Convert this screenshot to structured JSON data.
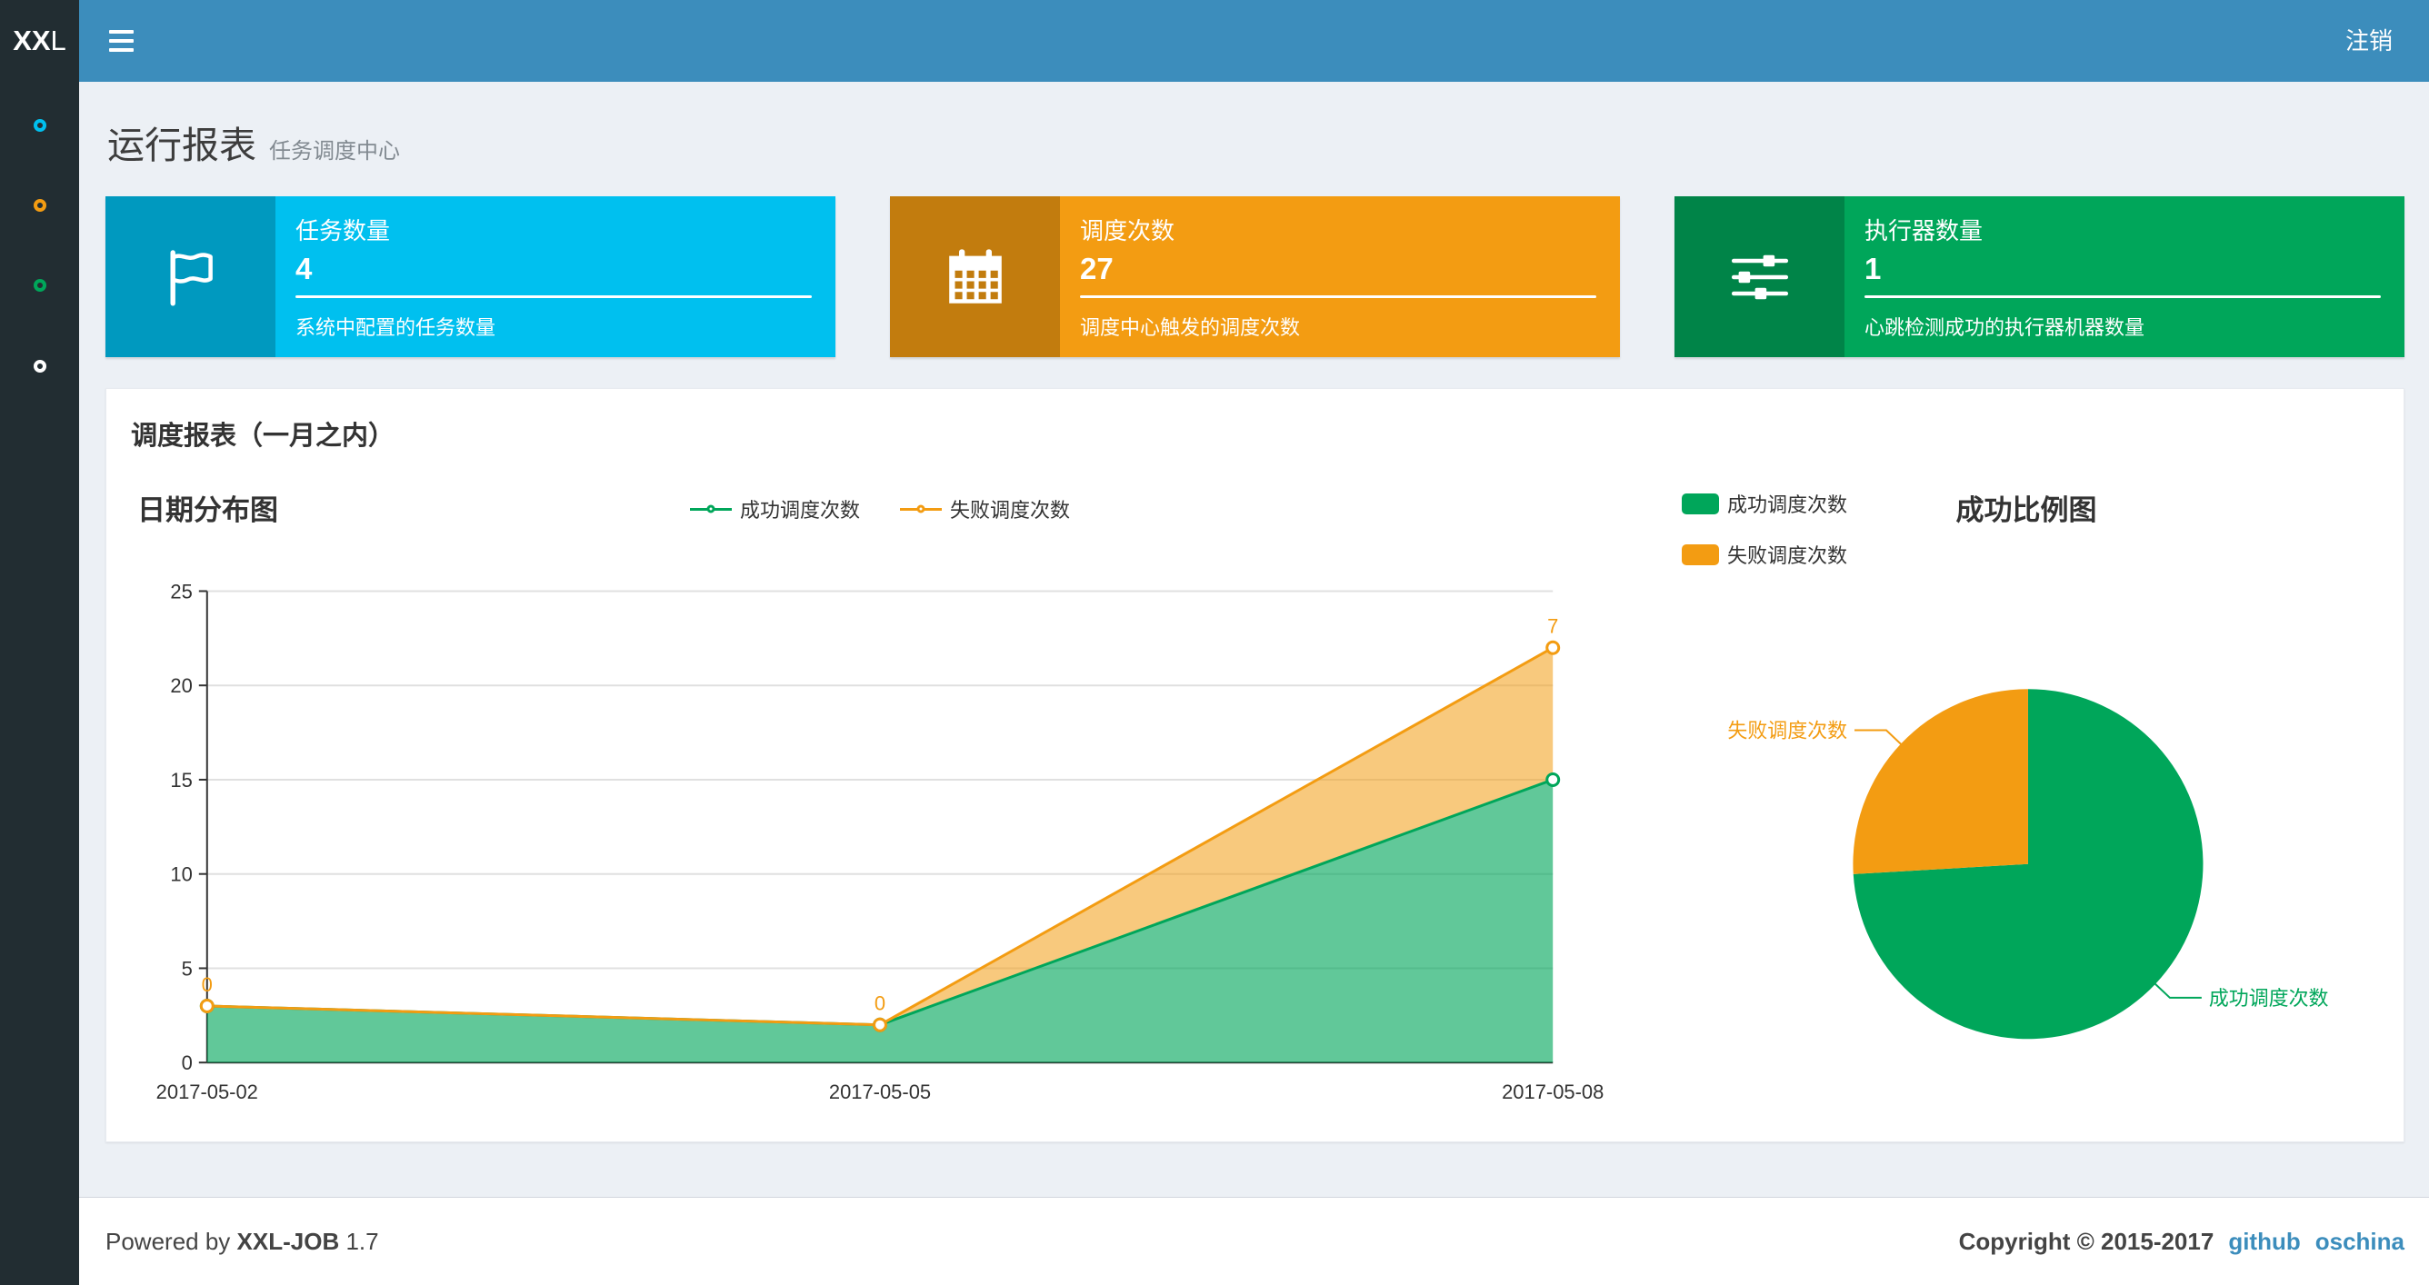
{
  "colors": {
    "navbar": "#3c8dbc",
    "sidebar": "#222d32",
    "content_bg": "#ecf0f5",
    "link": "#3c8dbc"
  },
  "navbar": {
    "logo_bold": "XX",
    "logo_rest": "L",
    "logout_label": "注销"
  },
  "sidebar": {
    "items": [
      {
        "icon": "circle-icon",
        "color": "#00c0ef"
      },
      {
        "icon": "circle-icon",
        "color": "#f39c12"
      },
      {
        "icon": "circle-icon",
        "color": "#00a65a"
      },
      {
        "icon": "circle-icon",
        "color": "#ffffff"
      }
    ]
  },
  "header": {
    "title": "运行报表",
    "subtitle": "任务调度中心"
  },
  "info_boxes": [
    {
      "icon": "flag-icon",
      "label": "任务数量",
      "value": "4",
      "desc": "系统中配置的任务数量",
      "color": "#00c0ef"
    },
    {
      "icon": "calendar-icon",
      "label": "调度次数",
      "value": "27",
      "desc": "调度中心触发的调度次数",
      "color": "#f39c12"
    },
    {
      "icon": "sliders-icon",
      "label": "执行器数量",
      "value": "1",
      "desc": "心跳检测成功的执行器机器数量",
      "color": "#00a65a"
    }
  ],
  "panel": {
    "title": "调度报表（一月之内）"
  },
  "chart_data": [
    {
      "type": "area",
      "title": "日期分布图",
      "x": [
        "2017-05-02",
        "2017-05-05",
        "2017-05-08"
      ],
      "series": [
        {
          "name": "成功调度次数",
          "color": "#00a65a",
          "values": [
            3,
            2,
            15
          ]
        },
        {
          "name": "失败调度次数",
          "color": "#f39c12",
          "values": [
            0,
            0,
            7
          ],
          "point_labels": [
            "0",
            "0",
            "7"
          ]
        }
      ],
      "stacked": true,
      "ylim": [
        0,
        25
      ],
      "yticks": [
        0,
        5,
        10,
        15,
        20,
        25
      ],
      "grid": true,
      "legend_position": "top-center"
    },
    {
      "type": "pie",
      "title": "成功比例图",
      "slices": [
        {
          "name": "成功调度次数",
          "value": 20,
          "color": "#00a65a"
        },
        {
          "name": "失败调度次数",
          "value": 7,
          "color": "#f39c12"
        }
      ],
      "legend_position": "top-left"
    }
  ],
  "footer": {
    "powered_prefix": "Powered by",
    "brand": "XXL-JOB",
    "version": "1.7",
    "copyright": "Copyright © 2015-2017",
    "links": [
      {
        "label": "github"
      },
      {
        "label": "oschina"
      }
    ]
  }
}
